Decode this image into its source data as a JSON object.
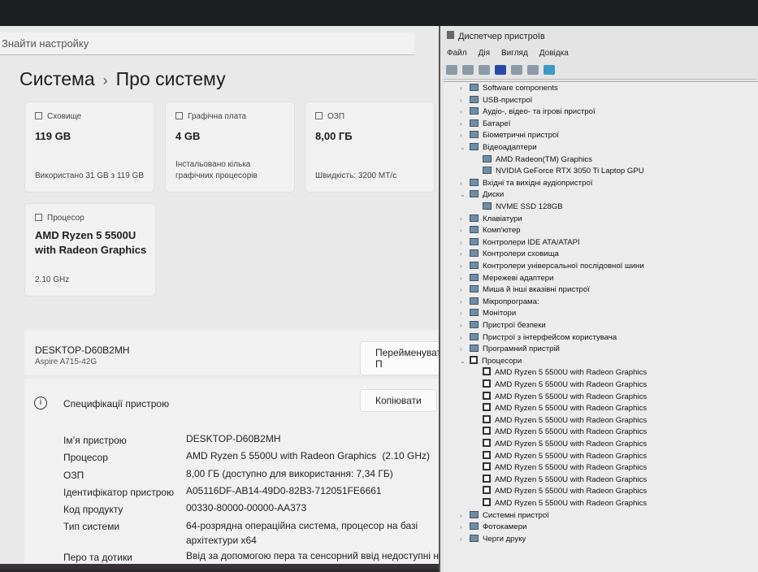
{
  "settings": {
    "search_placeholder": "Знайти настройку",
    "breadcrumb_parent": "Система",
    "breadcrumb_sep": "›",
    "page_title": "Про систему",
    "cards": [
      {
        "label": "Сховище",
        "value": "119 GB",
        "sub": "Використано 31 GB з 119 GB"
      },
      {
        "label": "Графічна плата",
        "value": "4 GB",
        "sub": "Інстальовано кілька графічних процесорів"
      },
      {
        "label": "ОЗП",
        "value": "8,00 ГБ",
        "sub": "Швидкість: 3200 MT/с"
      },
      {
        "label": "Процесор",
        "value": "AMD Ryzen 5 5500U with Radeon Graphics",
        "sub": "2.10 GHz"
      }
    ],
    "device_name": "DESKTOP-D60B2MH",
    "device_model": "Aspire A715-42G",
    "rename_button": "Перейменувати П",
    "spec_title": "Специфікації пристрою",
    "copy_button": "Копіювати",
    "specs": [
      {
        "k": "Ім’я пристрою",
        "v": "DESKTOP-D60B2MH"
      },
      {
        "k": "Процесор",
        "v": "AMD Ryzen 5 5500U with Radeon Graphics",
        "v2": "(2.10 GHz)"
      },
      {
        "k": "ОЗП",
        "v": "8,00 ГБ (доступно для використання: 7,34 ГБ)"
      },
      {
        "k": "Ідентифікатор пристрою",
        "v": "A05116DF-AB14-49D0-82B3-712051FE6661"
      },
      {
        "k": "Код продукту",
        "v": "00330-80000-00000-AA373"
      },
      {
        "k": "Тип системи",
        "v": "64-розрядна операційна система, процесор на базі архітектури x64"
      },
      {
        "k": "Перо та дотики",
        "v": "Ввід за допомогою пера та сенсорний ввід недоступні на"
      }
    ]
  },
  "devmgr": {
    "title": "Диспетчер пристроїв",
    "menu": [
      "Файл",
      "Дія",
      "Вигляд",
      "Довідка"
    ],
    "tree": [
      {
        "t": "Software components",
        "l": 0,
        "s": "c"
      },
      {
        "t": "USB-пристрої",
        "l": 0,
        "s": "c"
      },
      {
        "t": "Аудіо-, відео- та ігрові пристрої",
        "l": 0,
        "s": "c"
      },
      {
        "t": "Батареї",
        "l": 0,
        "s": "c"
      },
      {
        "t": "Біометричні пристрої",
        "l": 0,
        "s": "c"
      },
      {
        "t": "Відеоадаптери",
        "l": 0,
        "s": "e"
      },
      {
        "t": "AMD Radeon(TM) Graphics",
        "l": 1
      },
      {
        "t": "NVIDIA GeForce RTX 3050 Ti Laptop GPU",
        "l": 1
      },
      {
        "t": "Вхідні та вихідні аудіопристрої",
        "l": 0,
        "s": "c"
      },
      {
        "t": "Диски",
        "l": 0,
        "s": "e"
      },
      {
        "t": "NVME SSD 128GB",
        "l": 1
      },
      {
        "t": "Клавіатури",
        "l": 0,
        "s": "c"
      },
      {
        "t": "Комп'ютер",
        "l": 0,
        "s": "c"
      },
      {
        "t": "Контролери IDE ATA/ATAPI",
        "l": 0,
        "s": "c"
      },
      {
        "t": "Контролери сховища",
        "l": 0,
        "s": "c"
      },
      {
        "t": "Контролери універсальної послідовної шини",
        "l": 0,
        "s": "c"
      },
      {
        "t": "Мережеві адаптери",
        "l": 0,
        "s": "c"
      },
      {
        "t": "Миша й інші вказівні пристрої",
        "l": 0,
        "s": "c"
      },
      {
        "t": "Мікропрограма:",
        "l": 0,
        "s": "c"
      },
      {
        "t": "Монітори",
        "l": 0,
        "s": "c"
      },
      {
        "t": "Пристрої безпеки",
        "l": 0,
        "s": "c"
      },
      {
        "t": "Пристрої з інтерфейсом користувача",
        "l": 0,
        "s": "c"
      },
      {
        "t": "Програмний пристрій",
        "l": 0,
        "s": "c"
      },
      {
        "t": "Процесори",
        "l": 0,
        "s": "e",
        "cpu": true
      },
      {
        "t": "AMD Ryzen 5 5500U with Radeon Graphics",
        "l": 1,
        "cpu": true
      },
      {
        "t": "AMD Ryzen 5 5500U with Radeon Graphics",
        "l": 1,
        "cpu": true
      },
      {
        "t": "AMD Ryzen 5 5500U with Radeon Graphics",
        "l": 1,
        "cpu": true
      },
      {
        "t": "AMD Ryzen 5 5500U with Radeon Graphics",
        "l": 1,
        "cpu": true
      },
      {
        "t": "AMD Ryzen 5 5500U with Radeon Graphics",
        "l": 1,
        "cpu": true
      },
      {
        "t": "AMD Ryzen 5 5500U with Radeon Graphics",
        "l": 1,
        "cpu": true
      },
      {
        "t": "AMD Ryzen 5 5500U with Radeon Graphics",
        "l": 1,
        "cpu": true
      },
      {
        "t": "AMD Ryzen 5 5500U with Radeon Graphics",
        "l": 1,
        "cpu": true
      },
      {
        "t": "AMD Ryzen 5 5500U with Radeon Graphics",
        "l": 1,
        "cpu": true
      },
      {
        "t": "AMD Ryzen 5 5500U with Radeon Graphics",
        "l": 1,
        "cpu": true
      },
      {
        "t": "AMD Ryzen 5 5500U with Radeon Graphics",
        "l": 1,
        "cpu": true
      },
      {
        "t": "AMD Ryzen 5 5500U with Radeon Graphics",
        "l": 1,
        "cpu": true
      },
      {
        "t": "Системні пристрої",
        "l": 0,
        "s": "c"
      },
      {
        "t": "Фотокамери",
        "l": 0,
        "s": "c"
      },
      {
        "t": "Черги друку",
        "l": 0,
        "s": "c"
      }
    ]
  }
}
